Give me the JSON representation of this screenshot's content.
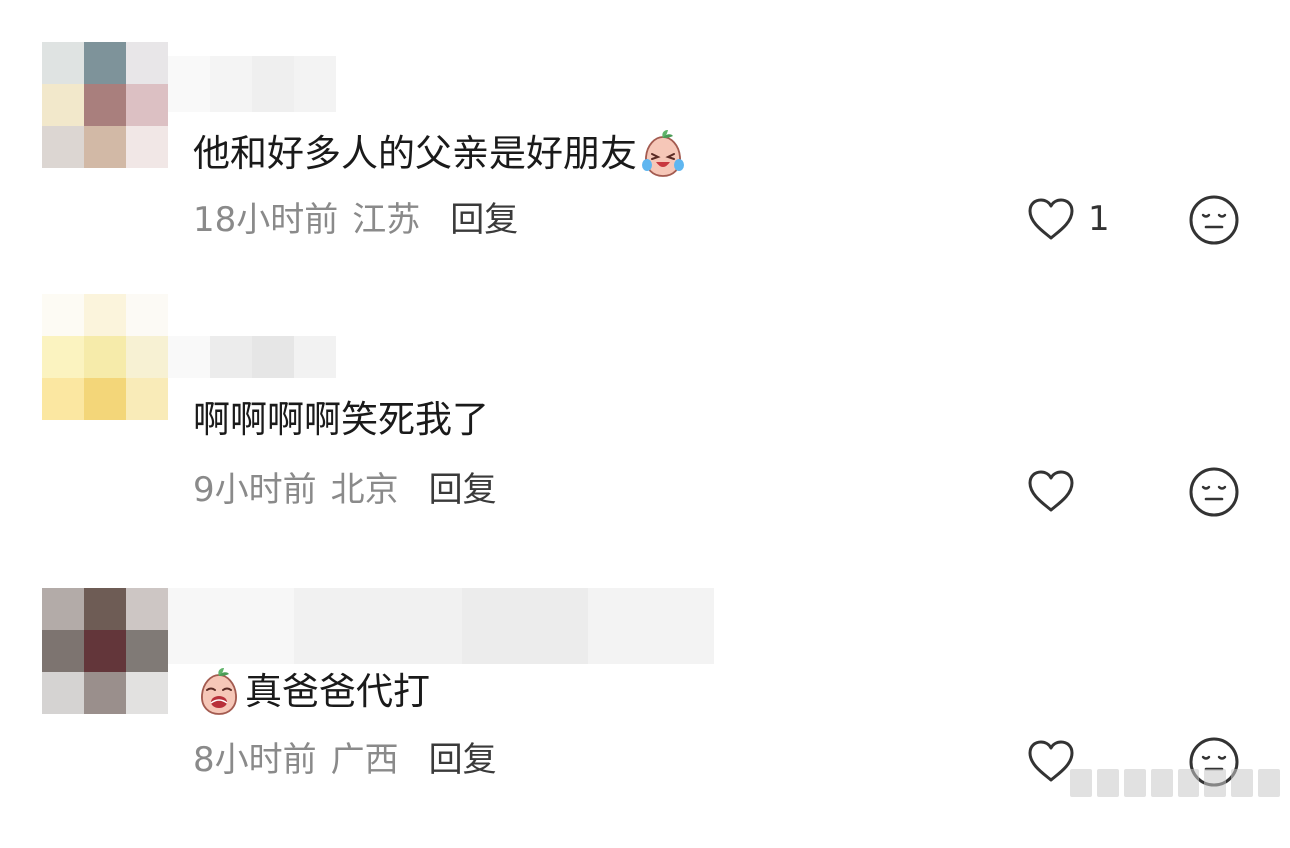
{
  "comments": [
    {
      "text": "他和好多人的父亲是好朋友",
      "emoji": "crying-laughing-peach-emoji",
      "emoji_position": "after",
      "time": "18小时前",
      "location": "江苏",
      "reply_label": "回复",
      "like_count": "1",
      "avatar_colors": [
        "#dfe3e2",
        "#7e939a",
        "#e8e6e8",
        "#f2e8cb",
        "#a97f7d",
        "#dcc0c3",
        "#dcd6d2",
        "#d2b9a6",
        "#f1e7e6"
      ],
      "username_colors": [
        "#f9f9f9",
        "#f4f4f4",
        "#efefef",
        "#f3f3f3"
      ]
    },
    {
      "text": "啊啊啊啊笑死我了",
      "emoji": "",
      "emoji_position": "",
      "time": "9小时前",
      "location": "北京",
      "reply_label": "回复",
      "like_count": "",
      "avatar_colors": [
        "#fdfbf4",
        "#fbf4dc",
        "#fcfaf5",
        "#fbf3c0",
        "#f6ebaa",
        "#f7f1d3",
        "#fbe7a1",
        "#f3d679",
        "#f9ebb8"
      ],
      "username_colors": [
        "#f9f9f9",
        "#ececec",
        "#e6e6e6",
        "#f2f2f2"
      ]
    },
    {
      "text": "真爸爸代打",
      "emoji": "crying-peach-emoji",
      "emoji_position": "before",
      "time": "8小时前",
      "location": "广西",
      "reply_label": "回复",
      "like_count": "",
      "avatar_colors": [
        "#b3aba8",
        "#6e5c55",
        "#cdc6c4",
        "#7d7470",
        "#63363a",
        "#807a76",
        "#d5d3d2",
        "#9a8f8c",
        "#e2e1e0"
      ],
      "username_colors": [
        "#f7f7f7",
        "#f1f1f1",
        "#ececec",
        "#f3f3f3"
      ]
    }
  ],
  "icons": {
    "like": "heart-outline-icon",
    "react": "neutral-face-icon"
  },
  "colors": {
    "meta_text": "#8a8a8a",
    "reply_text": "#3a3a3a",
    "comment_text": "#1a1a1a"
  }
}
